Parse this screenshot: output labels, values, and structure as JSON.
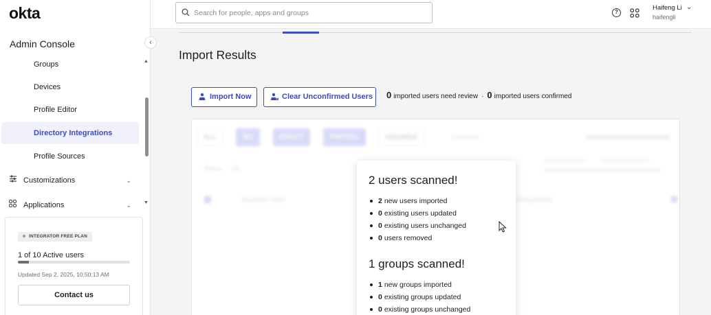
{
  "app": {
    "logo": "okta",
    "console_title": "Admin Console"
  },
  "sidebar": {
    "sub_items": [
      {
        "label": "Groups"
      },
      {
        "label": "Devices"
      },
      {
        "label": "Profile Editor"
      },
      {
        "label": "Directory Integrations",
        "active": true
      },
      {
        "label": "Profile Sources"
      }
    ],
    "groups": [
      {
        "label": "Customizations",
        "icon": "sliders-icon"
      },
      {
        "label": "Applications",
        "icon": "grid-icon"
      }
    ],
    "plan": {
      "badge": "INTEGRATOR FREE PLAN",
      "users_text": "1 of 10 Active users",
      "usage_fraction": 0.1,
      "updated": "Updated Sep 2, 2025, 10:50:13 AM",
      "contact_label": "Contact us"
    }
  },
  "header": {
    "search_placeholder": "Search for people, apps and groups",
    "help_icon": "question-circle-icon",
    "apps_icon": "app-grid-icon",
    "user_name": "Haifeng Li",
    "user_login": "haifengli"
  },
  "main": {
    "title": "Import Results",
    "import_now_label": "Import Now",
    "clear_label": "Clear Unconfirmed Users",
    "summary": {
      "review_count": "0",
      "review_text": "imported users need review",
      "separator": "·",
      "confirmed_count": "0",
      "confirmed_text": "imported users confirmed"
    },
    "background_table": {
      "filter_tabs": [
        "ALL",
        "NO",
        "EXACT",
        "PARTIAL",
        "IGNORED"
      ],
      "show_label": "Show",
      "show_value": "20",
      "column_user": "Imported User",
      "column_assignment": "Assignment"
    }
  },
  "modal": {
    "users_heading": "2 users scanned!",
    "users_stats": [
      {
        "count": "2",
        "text": "new users imported"
      },
      {
        "count": "0",
        "text": "existing users updated"
      },
      {
        "count": "0",
        "text": "existing users unchanged"
      },
      {
        "count": "0",
        "text": "users removed"
      }
    ],
    "groups_heading": "1 groups scanned!",
    "groups_stats": [
      {
        "count": "1",
        "text": "new groups imported"
      },
      {
        "count": "0",
        "text": "existing groups updated"
      },
      {
        "count": "0",
        "text": "existing groups unchanged"
      }
    ]
  },
  "colors": {
    "accent": "#3b4bc4",
    "active_bg": "#f0f1fb"
  }
}
